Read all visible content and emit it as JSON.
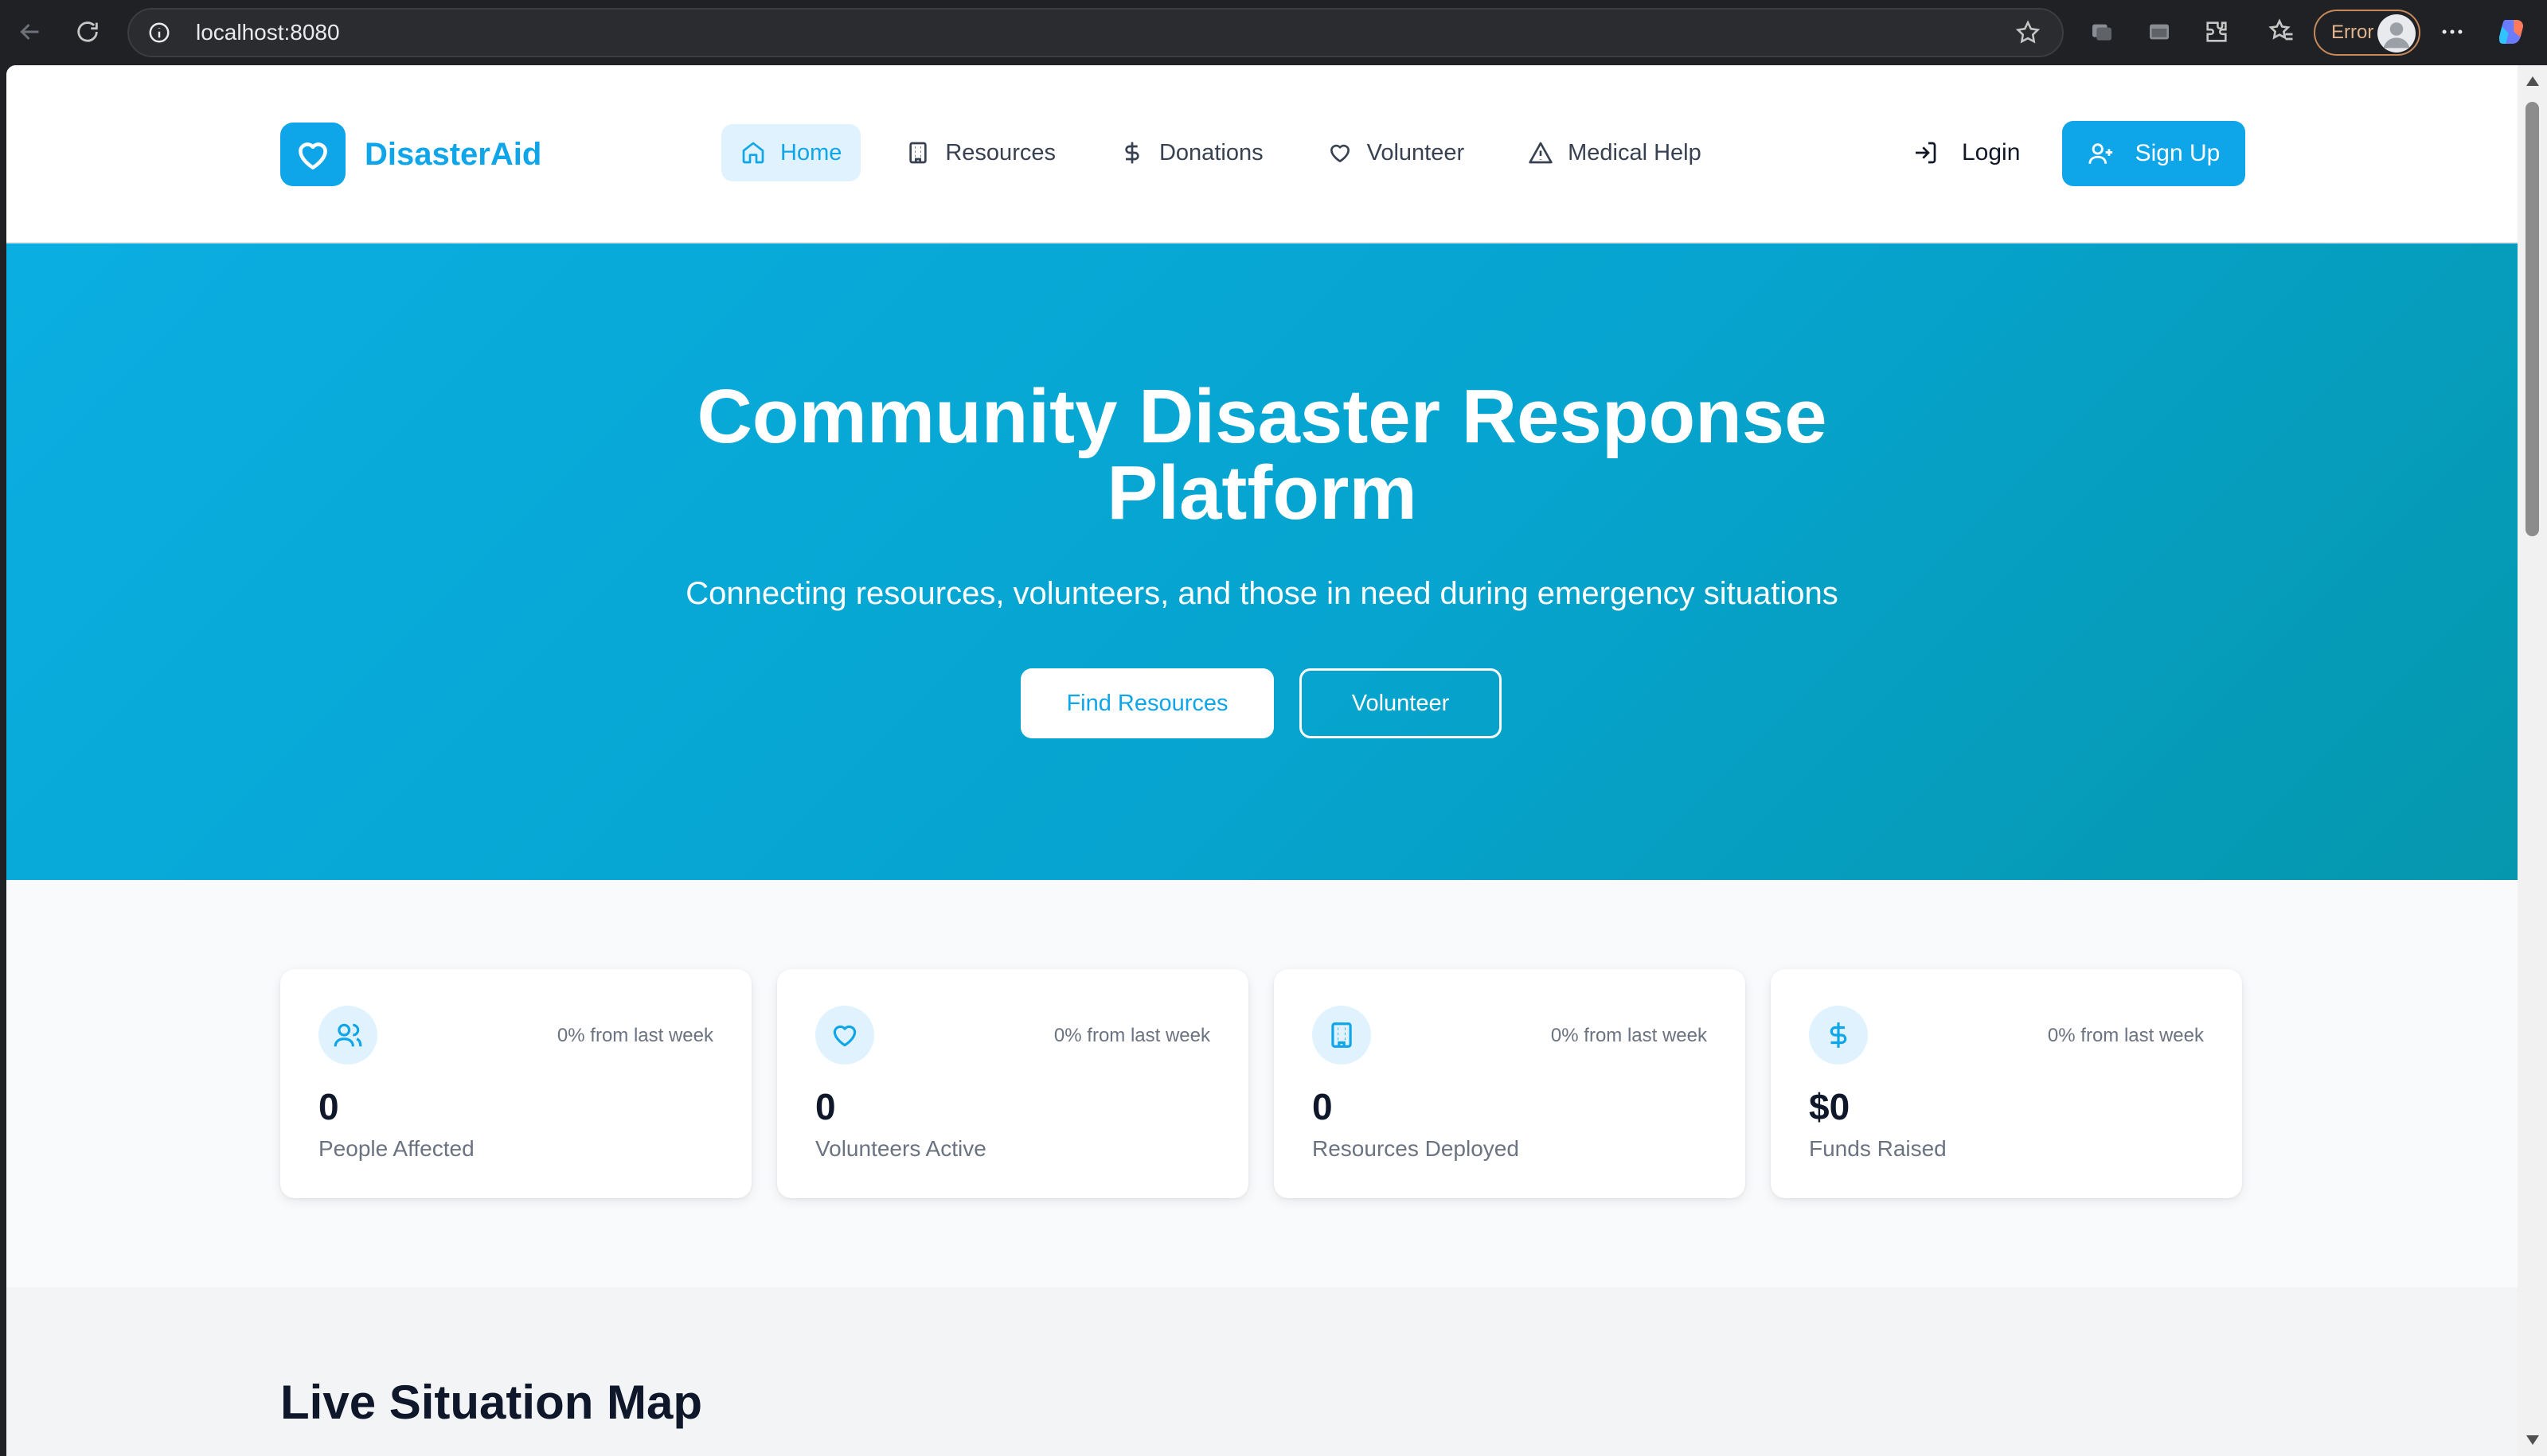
{
  "browser": {
    "url": "localhost:8080",
    "profile_status": "Error"
  },
  "app": {
    "brand": "DisasterAid",
    "nav": [
      {
        "label": "Home",
        "icon": "home-icon",
        "active": true
      },
      {
        "label": "Resources",
        "icon": "building-icon",
        "active": false
      },
      {
        "label": "Donations",
        "icon": "dollar-icon",
        "active": false
      },
      {
        "label": "Volunteer",
        "icon": "heart-icon",
        "active": false
      },
      {
        "label": "Medical Help",
        "icon": "alert-triangle-icon",
        "active": false
      }
    ],
    "login_label": "Login",
    "signup_label": "Sign Up"
  },
  "hero": {
    "title_line1": "Community Disaster Response",
    "title_line2": "Platform",
    "subtitle": "Connecting resources, volunteers, and those in need during emergency situations",
    "primary_button": "Find Resources",
    "secondary_button": "Volunteer"
  },
  "stats": [
    {
      "icon": "users-icon",
      "delta": "0% from last week",
      "value": "0",
      "label": "People Affected"
    },
    {
      "icon": "heart-icon",
      "delta": "0% from last week",
      "value": "0",
      "label": "Volunteers Active"
    },
    {
      "icon": "building-icon",
      "delta": "0% from last week",
      "value": "0",
      "label": "Resources Deployed"
    },
    {
      "icon": "dollar-icon",
      "delta": "0% from last week",
      "value": "$0",
      "label": "Funds Raised"
    }
  ],
  "map_section": {
    "title": "Live Situation Map"
  },
  "colors": {
    "accent": "#0ea5e9",
    "hero_start": "#0aaee0",
    "hero_end": "#0597ad"
  }
}
